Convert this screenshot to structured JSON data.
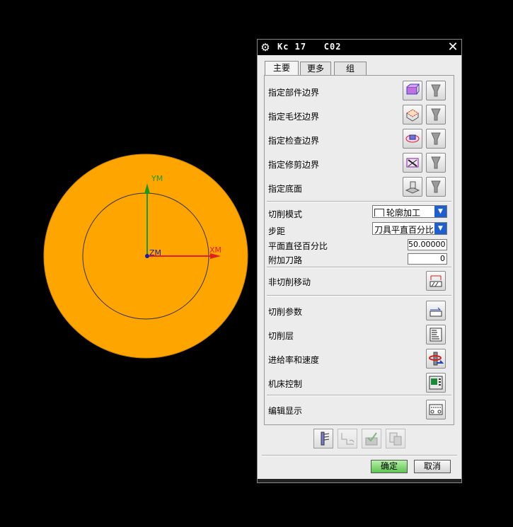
{
  "viewport": {
    "axis_y_label": "YM",
    "axis_x_label": "XM",
    "axis_z_label": "ZM",
    "colors": {
      "part_fill": "#ffa500",
      "y_axis": "#1a9a1a",
      "x_axis": "#e02020",
      "origin": "#1a1ab0",
      "background": "#000000"
    }
  },
  "dialog": {
    "title": "Kc 17   C02",
    "tabs": [
      {
        "label": "主要",
        "active": true
      },
      {
        "label": "更多",
        "active": false
      },
      {
        "label": "组",
        "active": false
      }
    ],
    "geometry_rows": [
      {
        "label": "指定部件边界",
        "icon": "part-boundary-icon"
      },
      {
        "label": "指定毛坯边界",
        "icon": "blank-boundary-icon"
      },
      {
        "label": "指定检查边界",
        "icon": "check-boundary-icon"
      },
      {
        "label": "指定修剪边界",
        "icon": "trim-boundary-icon"
      },
      {
        "label": "指定底面",
        "icon": "floor-icon"
      }
    ],
    "cut_pattern": {
      "label": "切削模式",
      "value": "轮廓加工"
    },
    "stepover": {
      "label": "步距",
      "value": "刀具平直百分比"
    },
    "flat_diameter": {
      "label": "平面直径百分比",
      "value": "50.00000"
    },
    "additional_passes": {
      "label": "附加刀路",
      "value": "0"
    },
    "non_cutting": {
      "label": "非切削移动"
    },
    "settings_rows": [
      {
        "label": "切削参数",
        "icon": "cutting-params-icon"
      },
      {
        "label": "切削层",
        "icon": "cut-levels-icon"
      },
      {
        "label": "进给率和速度",
        "icon": "feeds-speeds-icon"
      },
      {
        "label": "机床控制",
        "icon": "machine-control-icon"
      },
      {
        "label": "编辑显示",
        "icon": "edit-display-icon"
      }
    ],
    "bottom_icons": [
      "generate-icon",
      "replay-icon",
      "verify-icon",
      "list-icon"
    ],
    "ok_label": "确定",
    "cancel_label": "取消",
    "accent_colors": {
      "ok_button": "#6ccc5c",
      "dropdown_arrow": "#1e5fd0"
    }
  }
}
